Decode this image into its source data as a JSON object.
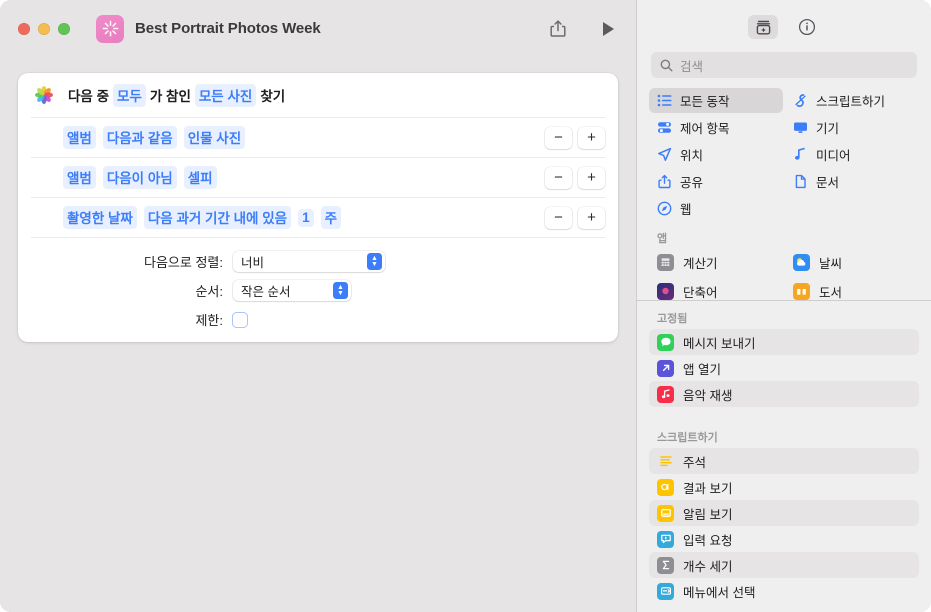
{
  "window": {
    "title": "Best Portrait Photos Week",
    "app_icon": "shortcuts-sparkle-icon",
    "traffic_lights": [
      "close",
      "minimize",
      "zoom"
    ],
    "actions": [
      {
        "name": "share-button",
        "icon": "share-icon"
      },
      {
        "name": "run-button",
        "icon": "play-icon"
      }
    ]
  },
  "editor": {
    "card": {
      "app_icon": "photos-icon",
      "header": {
        "parts": [
          {
            "text": "다음 중",
            "type": "plain"
          },
          {
            "text": "모두",
            "type": "token"
          },
          {
            "text": "가 참인",
            "type": "plain"
          },
          {
            "text": "모든 사진",
            "type": "token"
          },
          {
            "text": "찾기",
            "type": "plain"
          }
        ]
      },
      "rules": [
        {
          "tokens": [
            "앨범",
            "다음과 같음",
            "인물 사진"
          ],
          "remove": "−",
          "add": "+"
        },
        {
          "tokens": [
            "앨범",
            "다음이 아님",
            "셀피"
          ],
          "remove": "−",
          "add": "+"
        },
        {
          "tokens": [
            "촬영한 날짜",
            "다음 과거 기간 내에 있음",
            "1",
            "주"
          ],
          "remove": "−",
          "add": "+"
        }
      ],
      "options": [
        {
          "label": "다음으로 정렬:",
          "type": "select",
          "value": "너비"
        },
        {
          "label": "순서:",
          "type": "select",
          "value": "작은 순서"
        },
        {
          "label": "제한:",
          "type": "checkbox",
          "checked": false
        }
      ]
    }
  },
  "sidebar": {
    "toolbar": [
      {
        "name": "action-library-button",
        "icon": "add-action-icon",
        "selected": true
      },
      {
        "name": "shortcut-details-button",
        "icon": "info-circle-icon",
        "selected": false
      }
    ],
    "search": {
      "placeholder": "검색",
      "value": "",
      "icon": "search-icon"
    },
    "categories": [
      {
        "label": "모든 동작",
        "icon": "list-icon",
        "color": "#3b7dfa",
        "selected": true
      },
      {
        "label": "스크립트하기",
        "icon": "script-icon",
        "color": "#3b7dfa",
        "selected": false
      },
      {
        "label": "제어 항목",
        "icon": "sliders-icon",
        "color": "#3b7dfa",
        "selected": false
      },
      {
        "label": "기기",
        "icon": "display-icon",
        "color": "#3b7dfa",
        "selected": false
      },
      {
        "label": "위치",
        "icon": "location-icon",
        "color": "#3b7dfa",
        "selected": false
      },
      {
        "label": "미디어",
        "icon": "music-note-icon",
        "color": "#3b7dfa",
        "selected": false
      },
      {
        "label": "공유",
        "icon": "share-icon",
        "color": "#3b7dfa",
        "selected": false
      },
      {
        "label": "문서",
        "icon": "document-icon",
        "color": "#3b7dfa",
        "selected": false
      },
      {
        "label": "웹",
        "icon": "safari-icon",
        "color": "#3b7dfa",
        "selected": false
      }
    ],
    "apps_section": {
      "title": "앱",
      "items": [
        {
          "label": "계산기",
          "icon": "calculator-icon",
          "color": "#6e6e73"
        },
        {
          "label": "날씨",
          "icon": "weather-icon",
          "color": "#2f8ef4"
        },
        {
          "label": "단축어",
          "icon": "shortcuts-icon",
          "color": "#1d1d4f"
        },
        {
          "label": "도서",
          "icon": "books-icon",
          "color": "#f5a623"
        }
      ]
    },
    "pinned_section": {
      "title": "고정됨",
      "items": [
        {
          "label": "메시지 보내기",
          "icon": "messages-icon",
          "color": "#30d158",
          "alt": true
        },
        {
          "label": "앱 열기",
          "icon": "open-app-icon",
          "color": "#5a54d8",
          "alt": false
        },
        {
          "label": "음악 재생",
          "icon": "music-play-icon",
          "color": "#fa2d48",
          "alt": true
        }
      ]
    },
    "scripting_section": {
      "title": "스크립트하기",
      "items": [
        {
          "label": "주석",
          "icon": "comment-icon",
          "color": "#ffffff",
          "alt": true
        },
        {
          "label": "결과 보기",
          "icon": "quicklook-icon",
          "color": "#ffc400",
          "alt": false
        },
        {
          "label": "알림 보기",
          "icon": "alert-icon",
          "color": "#ffc400",
          "alt": true
        },
        {
          "label": "입력 요청",
          "icon": "ask-input-icon",
          "color": "#34aadc",
          "alt": false
        },
        {
          "label": "개수 세기",
          "icon": "count-icon",
          "color": "#8e8e93",
          "alt": true
        },
        {
          "label": "메뉴에서 선택",
          "icon": "menu-select-icon",
          "color": "#34aadc",
          "alt": false
        }
      ]
    }
  },
  "colors": {
    "accent": "#3b7dfa",
    "token_bg": "#e8f0ff",
    "window_bg": "#e6e4e5",
    "sidebar_bg": "#f0eff0",
    "card_bg": "#ffffff"
  }
}
